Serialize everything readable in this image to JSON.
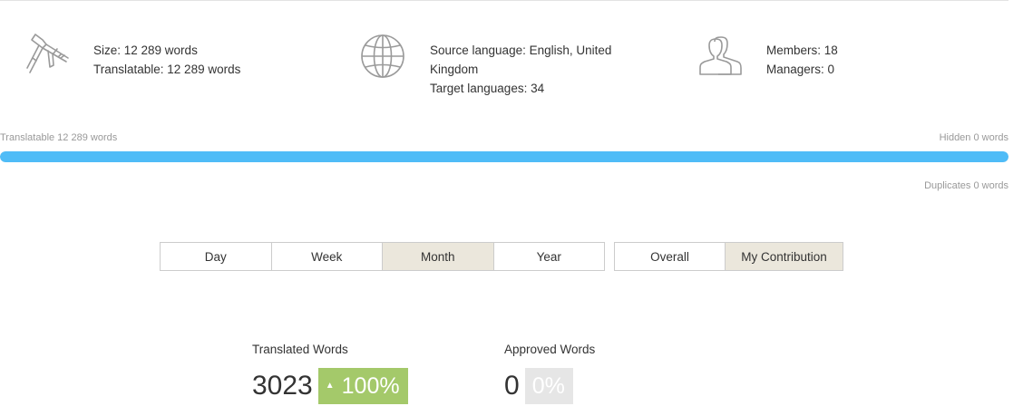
{
  "stats": {
    "size": {
      "icon": "caliper-icon",
      "line1": "Size: 12 289 words",
      "line2": "Translatable: 12 289 words"
    },
    "languages": {
      "icon": "globe-icon",
      "line1": "Source language: English, United Kingdom",
      "line2": "Target languages: 34"
    },
    "members": {
      "icon": "users-icon",
      "line1": "Members: 18",
      "line2": "Managers: 0"
    }
  },
  "progress": {
    "left_label": "Translatable 12 289 words",
    "right_label": "Hidden 0 words",
    "below_label": "Duplicates 0 words",
    "fill_fraction": 1.0,
    "fill_color": "#4fbcf7"
  },
  "periods": {
    "items": [
      "Day",
      "Week",
      "Month",
      "Year"
    ],
    "active": "Month"
  },
  "scope": {
    "items": [
      "Overall",
      "My Contribution"
    ],
    "active": "My Contribution"
  },
  "metrics": {
    "translated": {
      "label": "Translated Words",
      "value": "3023",
      "badge_arrow": "▲",
      "badge": "100%",
      "badge_color": "#a4c96a"
    },
    "approved": {
      "label": "Approved Words",
      "value": "0",
      "badge": "0%",
      "badge_color": "#e6e6e6"
    }
  }
}
